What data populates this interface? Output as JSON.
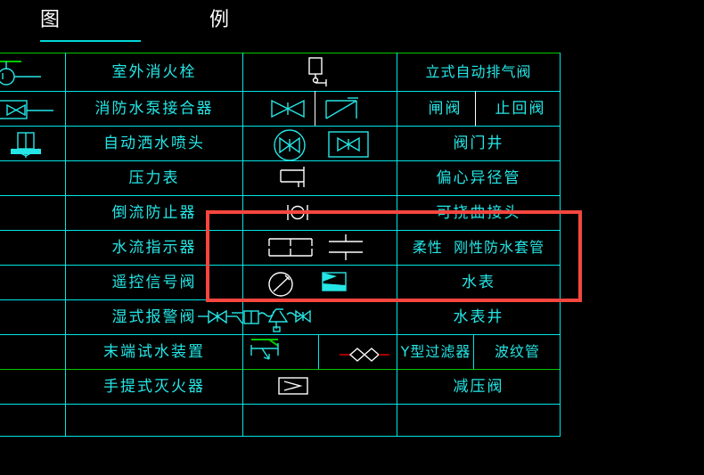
{
  "title": {
    "text": "图    例",
    "color": "#ffffff",
    "rule_color": "#00d8d8"
  },
  "colors": {
    "background": "#000000",
    "grid": "#00e5e5",
    "grid_accent": "#00c800",
    "text": "#25e6e6",
    "highlight": "#f8463f",
    "symbol_white": "#ffffff",
    "symbol_magenta": "#e400e4"
  },
  "highlight": {
    "name": "red-selection-rectangle",
    "covers_rows": [
      5,
      6,
      7
    ],
    "color": "#f8463f"
  },
  "table": {
    "columns": [
      "symbol",
      "name",
      "symbol",
      "name"
    ],
    "rows": [
      {
        "left_symbol": "outdoor-fire-hydrant-symbol",
        "left_label": "室外消火栓",
        "right_symbol": "vertical-automatic-air-vent-valve-symbol",
        "right_label": "立式自动排气阀",
        "right_label_split": false
      },
      {
        "left_symbol": "fire-pump-adapter-symbol",
        "left_label": "消防水泵接合器",
        "right_symbol": "gate-valve-and-check-valve-symbol",
        "right_label": "闸阀     止回阀",
        "right_label_split": true,
        "right_label_a": "闸阀",
        "right_label_b": "止回阀"
      },
      {
        "left_symbol": "automatic-sprinkler-head-symbol",
        "left_label": "自动洒水喷头",
        "right_symbol": "valve-well-symbol",
        "right_label": "阀门井",
        "right_label_split": false
      },
      {
        "left_symbol": "pressure-gauge-symbol",
        "left_label": "压力表",
        "right_symbol": "eccentric-reducer-symbol",
        "right_label": "偏心异径管",
        "right_label_split": false
      },
      {
        "left_symbol": "backflow-preventer-symbol",
        "left_label": "倒流防止器",
        "right_symbol": "flexible-joint-symbol",
        "right_label": "可挠曲接头",
        "right_label_split": false
      },
      {
        "left_symbol": "water-flow-indicator-symbol",
        "left_label": "水流指示器",
        "right_symbol": "flexible-rigid-waterproof-sleeve-symbol",
        "right_label": "柔性  刚性防水套管",
        "right_label_split": false
      },
      {
        "left_symbol": "remote-control-signal-valve-symbol",
        "left_label": "遥控信号阀",
        "right_symbol": "water-meter-symbol",
        "right_label": "水表",
        "right_label_split": false
      },
      {
        "left_symbol": "wet-alarm-valve-symbol",
        "left_label": "湿式报警阀",
        "right_symbol": "water-meter-well-symbol",
        "right_label": "水表井",
        "right_label_split": false
      },
      {
        "left_symbol": "end-of-line-test-device-symbol",
        "left_label": "末端试水装置",
        "right_symbol": "y-strainer-and-corrugated-pipe-symbol",
        "right_label": "Y型过滤器   波纹管",
        "right_label_split": true,
        "right_label_a": "Y型过滤器",
        "right_label_b": "波纹管"
      },
      {
        "left_symbol": "portable-fire-extinguisher-symbol",
        "left_label": "手提式灭火器",
        "right_symbol": "pressure-reducing-valve-symbol",
        "right_label": "减压阀",
        "right_label_split": false
      }
    ]
  }
}
